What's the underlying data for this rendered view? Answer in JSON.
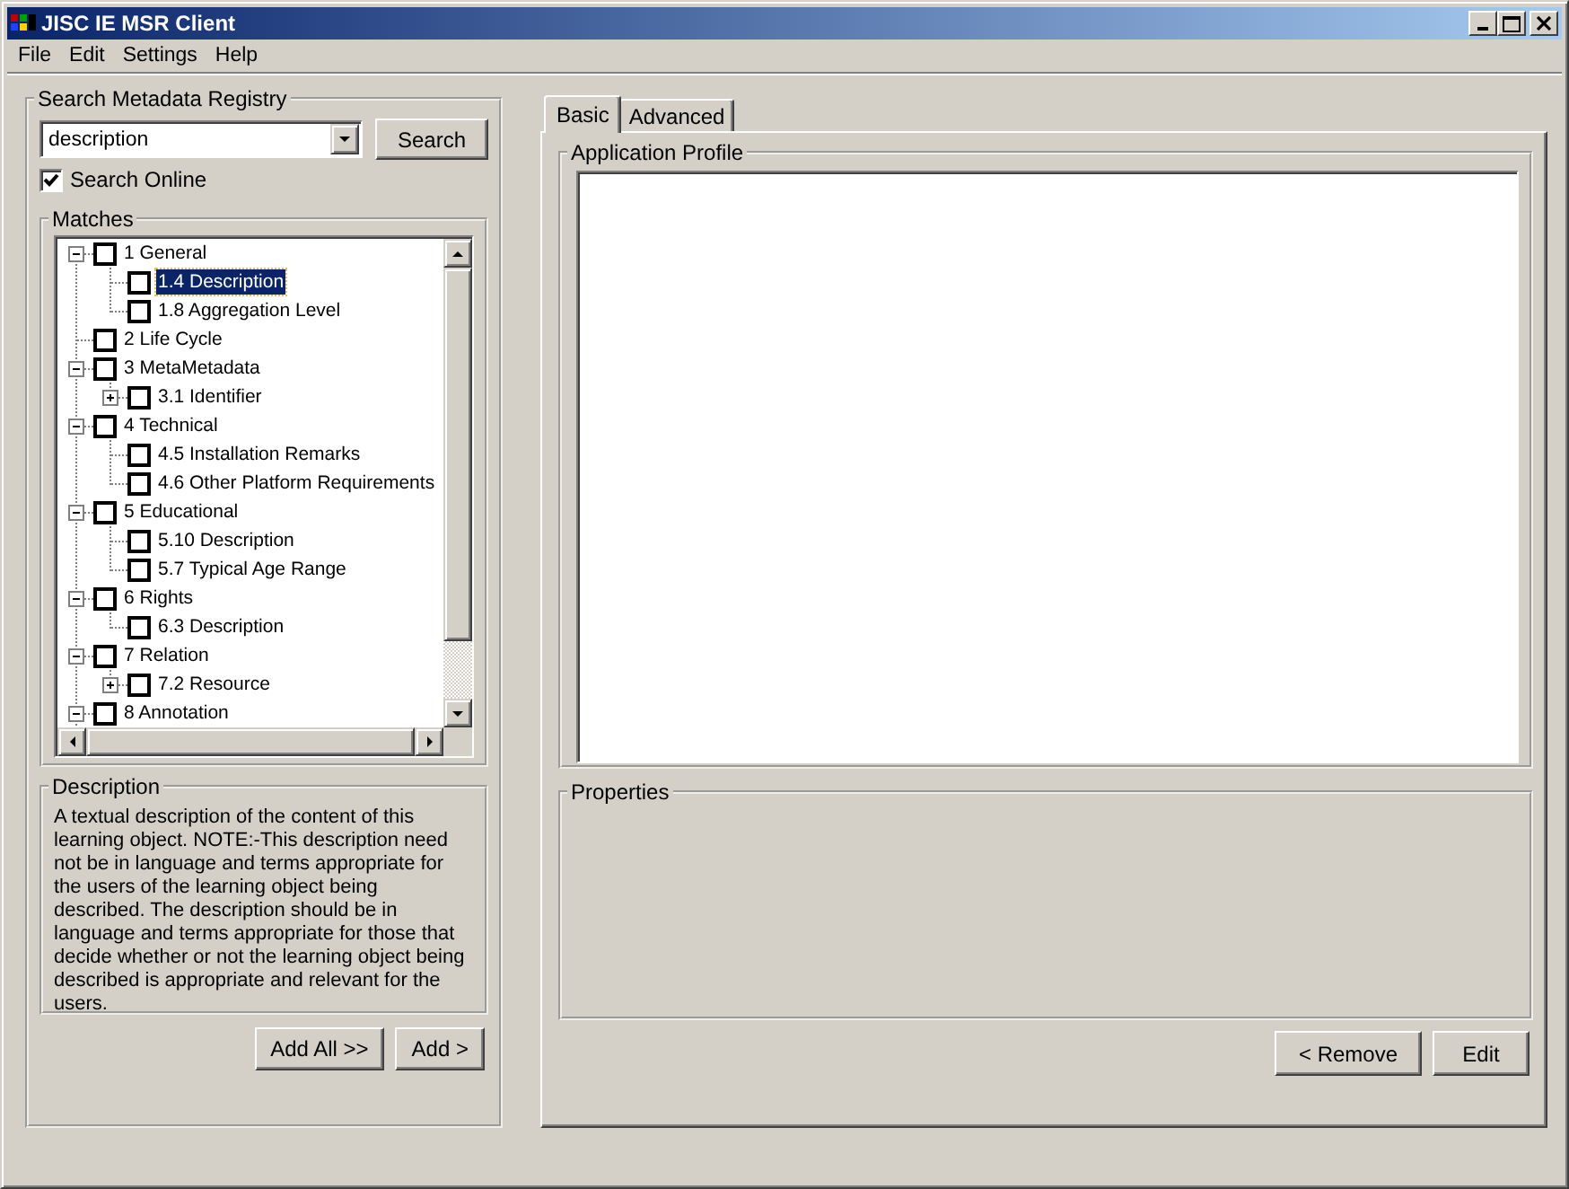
{
  "window": {
    "title": "JISC IE MSR Client"
  },
  "menu": [
    {
      "label": "File"
    },
    {
      "label": "Edit"
    },
    {
      "label": "Settings"
    },
    {
      "label": "Help"
    }
  ],
  "search": {
    "legend": "Search Metadata Registry",
    "value": "description",
    "button": "Search",
    "online": {
      "label": "Search Online",
      "checked": true
    }
  },
  "matches": {
    "legend": "Matches",
    "tree": [
      {
        "label": "1 General",
        "checked": false,
        "selected": false,
        "expanded": true,
        "children": [
          {
            "label": "1.4 Description",
            "checked": false,
            "selected": true
          },
          {
            "label": "1.8 Aggregation Level",
            "checked": false,
            "selected": false
          }
        ]
      },
      {
        "label": "2 Life Cycle",
        "checked": false,
        "selected": false
      },
      {
        "label": "3 MetaMetadata",
        "checked": false,
        "selected": false,
        "expanded": true,
        "children": [
          {
            "label": "3.1 Identifier",
            "checked": false,
            "selected": false,
            "expanded": false
          }
        ]
      },
      {
        "label": "4 Technical",
        "checked": false,
        "selected": false,
        "expanded": true,
        "children": [
          {
            "label": "4.5 Installation Remarks",
            "checked": false,
            "selected": false
          },
          {
            "label": "4.6 Other Platform Requirements",
            "checked": false,
            "selected": false
          }
        ]
      },
      {
        "label": "5 Educational",
        "checked": false,
        "selected": false,
        "expanded": true,
        "children": [
          {
            "label": "5.10 Description",
            "checked": false,
            "selected": false
          },
          {
            "label": "5.7 Typical Age Range",
            "checked": false,
            "selected": false
          }
        ]
      },
      {
        "label": "6 Rights",
        "checked": false,
        "selected": false,
        "expanded": true,
        "children": [
          {
            "label": "6.3 Description",
            "checked": false,
            "selected": false
          }
        ]
      },
      {
        "label": "7 Relation",
        "checked": false,
        "selected": false,
        "expanded": true,
        "children": [
          {
            "label": "7.2 Resource",
            "checked": false,
            "selected": false,
            "expanded": false
          }
        ]
      },
      {
        "label": "8 Annotation",
        "checked": false,
        "selected": false,
        "expanded": true
      }
    ]
  },
  "description": {
    "legend": "Description",
    "text": "A textual description of the content of this learning object. NOTE:-This description need not be in language and terms appropriate for the users of the learning object being described. The description should be in language and terms appropriate for those that decide whether or not the learning object being described is appropriate and relevant for the users."
  },
  "left_buttons": [
    {
      "label": "Add All >>"
    },
    {
      "label": "Add >"
    }
  ],
  "tabs": [
    {
      "label": "Basic",
      "selected": true
    },
    {
      "label": "Advanced",
      "selected": false
    }
  ],
  "application_profile": {
    "legend": "Application Profile"
  },
  "properties": {
    "legend": "Properties"
  },
  "right_buttons": [
    {
      "label": "< Remove"
    },
    {
      "label": "Edit"
    }
  ]
}
